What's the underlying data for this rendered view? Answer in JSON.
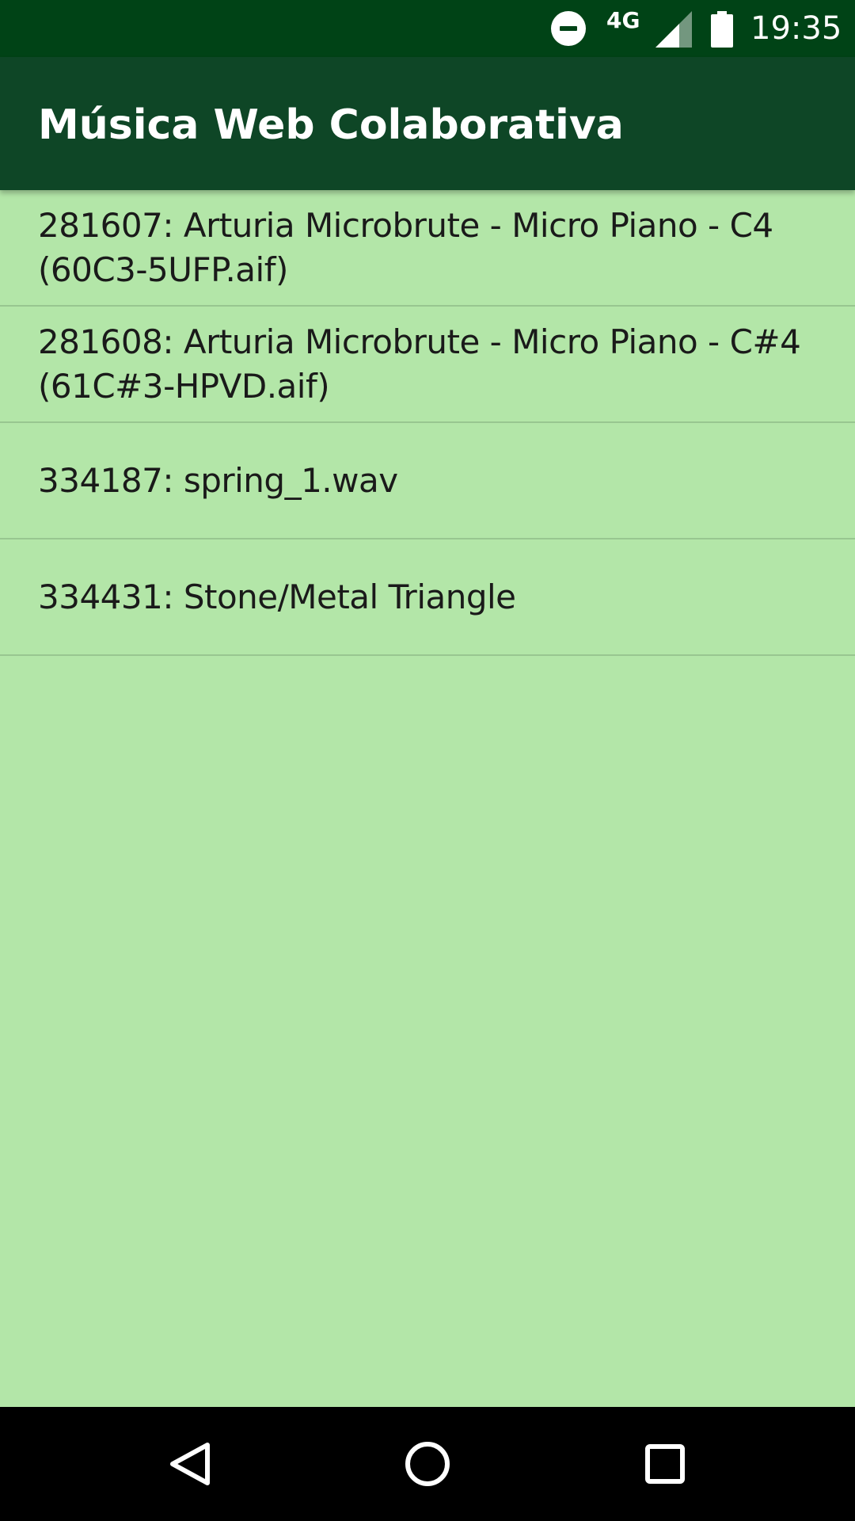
{
  "status_bar": {
    "network": "4G",
    "time": "19:35",
    "icons": [
      "do-not-disturb-icon",
      "signal-icon",
      "battery-icon"
    ]
  },
  "app_bar": {
    "title": "Música Web Colaborativa"
  },
  "list": {
    "items": [
      {
        "label": "281607: Arturia Microbrute - Micro Piano - C4 (60C3-5UFP.aif)"
      },
      {
        "label": "281608: Arturia Microbrute - Micro Piano - C#4 (61C#3-HPVD.aif)"
      },
      {
        "label": "334187: spring_1.wav"
      },
      {
        "label": "334431: Stone/Metal Triangle"
      }
    ]
  },
  "nav_bar": {
    "icons": [
      "back-icon",
      "home-icon",
      "recents-icon"
    ]
  },
  "colors": {
    "status_bar": "#004316",
    "app_bar": "#0e4626",
    "background": "#b3e6a8",
    "divider": "#98c690",
    "nav_bar": "#000000"
  }
}
